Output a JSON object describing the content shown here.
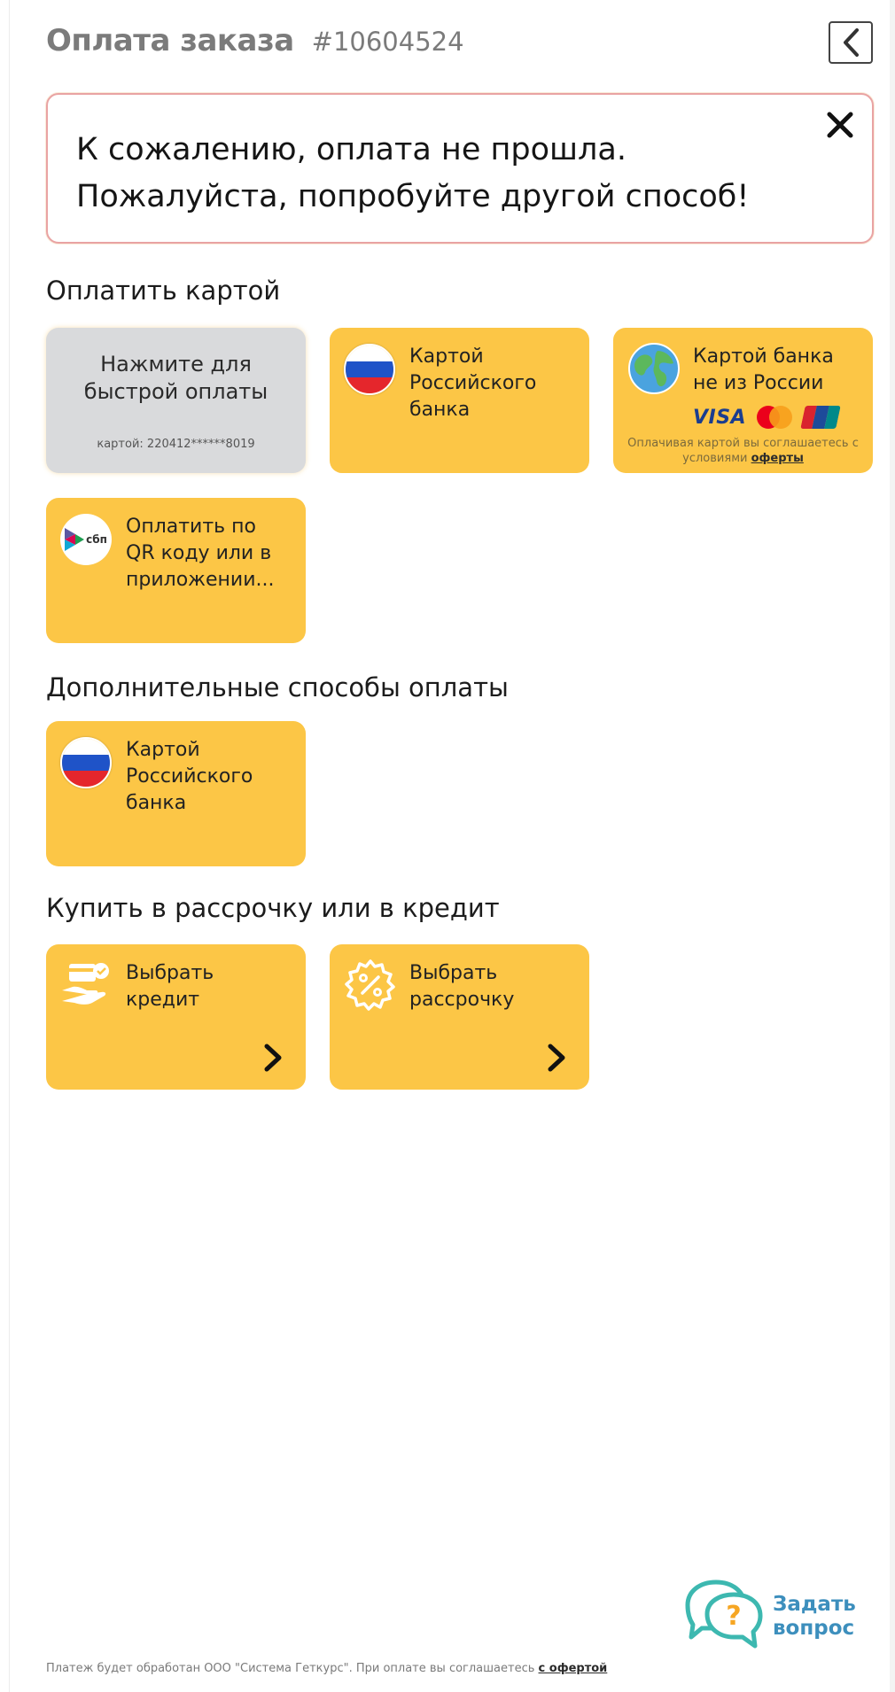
{
  "header": {
    "title": "Оплата заказа",
    "order_number": "#10604524"
  },
  "alert": {
    "line1": "К сожалению, оплата не прошла.",
    "line2": "Пожалуйста, попробуйте другой способ!"
  },
  "sections": {
    "card_title": "Оплатить картой",
    "extra_title": "Дополнительные способы оплаты",
    "credit_title": "Купить в рассрочку или в кредит"
  },
  "quick_pay": {
    "label_line1": "Нажмите для",
    "label_line2": "быстрой оплаты",
    "card_info": "картой: 220412******8019"
  },
  "russian_card": {
    "line1": "Картой",
    "line2": "Российского",
    "line3": "банка"
  },
  "foreign_card": {
    "line1": "Картой банка",
    "line2": "не из России",
    "visa": "VISA",
    "note_line1": "Оплачивая картой вы соглашаетесь с",
    "note_line2_prefix": "условиями ",
    "note_link": "оферты"
  },
  "sbp": {
    "logo_text": "сбп",
    "line1": "Оплатить по",
    "line2": "QR коду или в",
    "line3": "приложении..."
  },
  "extra_russian_card": {
    "line1": "Картой",
    "line2": "Российского",
    "line3": "банка"
  },
  "credit": {
    "line1": "Выбрать",
    "line2": "кредит"
  },
  "installment": {
    "line1": "Выбрать",
    "line2": "рассрочку"
  },
  "help": {
    "line1": "Задать",
    "line2": "вопрос"
  },
  "footer": {
    "text": "Платеж будет обработан ООО \"Система Геткурс\". При оплате вы соглашаетесь ",
    "link": "с офертой"
  },
  "colors": {
    "card_yellow": "#fcc646",
    "quick_gray": "#d9dadc",
    "alert_border": "#e9a3a3",
    "help_teal": "#3db8b0",
    "help_text_blue": "#3d8fbd"
  }
}
